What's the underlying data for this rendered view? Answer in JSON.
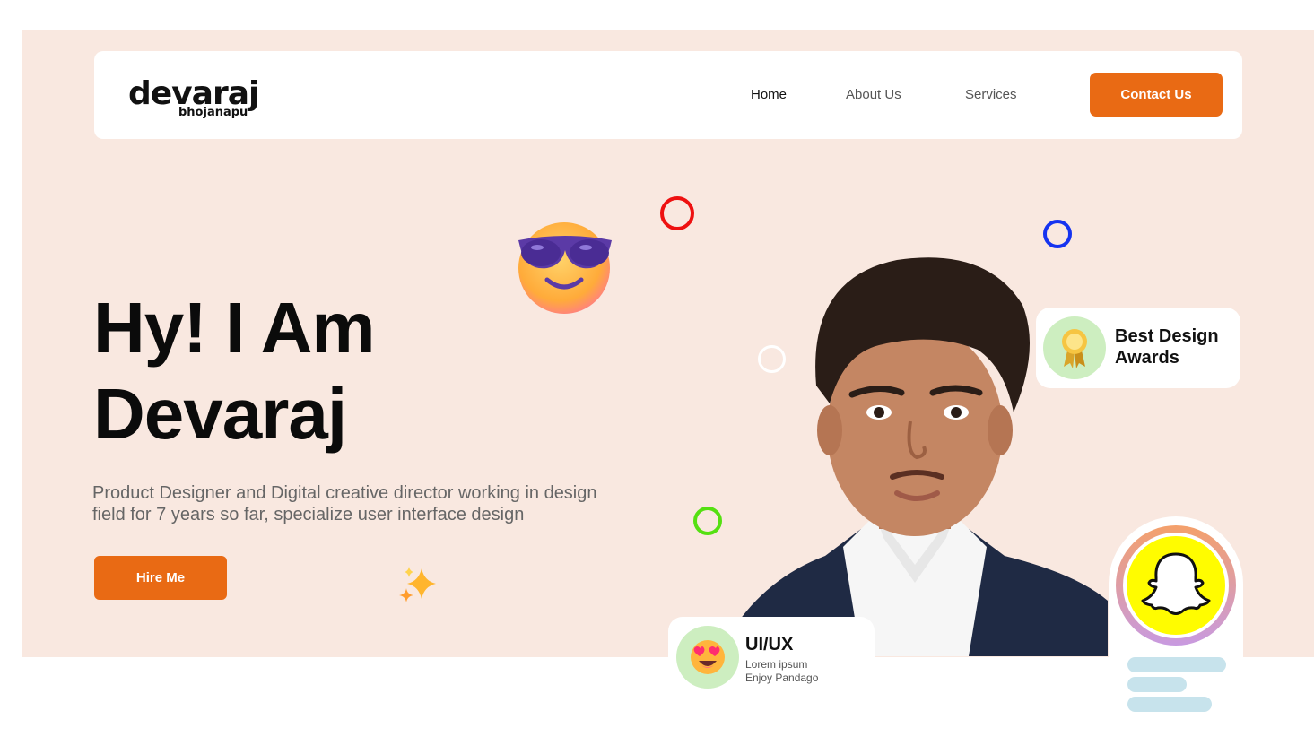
{
  "logo": {
    "main": "devaraj",
    "sub": "bhojanapu"
  },
  "nav": {
    "links": [
      "Home",
      "About Us",
      "Services"
    ],
    "active": "Home",
    "cta": "Contact Us"
  },
  "hero": {
    "headline_line1": "Hy! I Am",
    "headline_line2": "Devaraj",
    "subtitle_line1": "Product Designer and Digital creative director working in design",
    "subtitle_line2": "field for 7 years so far, specialize user interface design",
    "cta": "Hire Me"
  },
  "award_card": {
    "line1": "Best Design",
    "line2": "Awards",
    "icon": "award-ribbon-icon"
  },
  "uiux_card": {
    "title": "UI/UX",
    "line1": "Lorem ipsum",
    "line2": "Enjoy Pandago",
    "icon": "heart-eyes-emoji-icon"
  },
  "social": {
    "icon": "snapchat-icon"
  },
  "colors": {
    "accent": "#e96a14",
    "hero_bg": "#f9e8e0",
    "ring_red": "#ee1111",
    "ring_blue": "#1533f0",
    "ring_green": "#55e012",
    "ring_white": "#ffffff",
    "snap_yellow": "#fffc00",
    "badge_green": "#cdeec0",
    "bar_blue": "#c7e3ec"
  }
}
